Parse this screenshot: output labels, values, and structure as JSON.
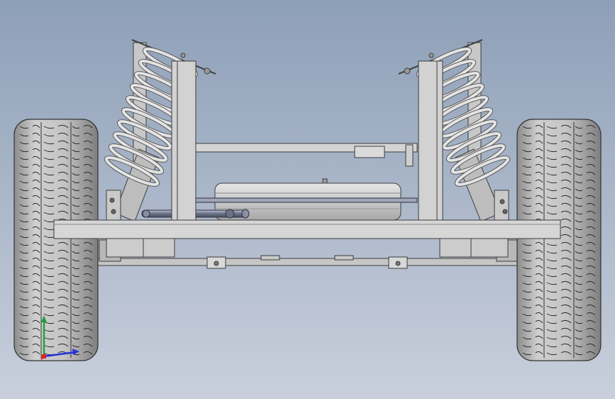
{
  "viewport": {
    "background_top": "#8D9FB7",
    "background_bottom": "#C9CFDC"
  },
  "model": {
    "part_fill": "#D0D0D0",
    "part_stroke": "#3C3C3C",
    "tire_fill": "#BDBDBD",
    "spring_fill": "#E2E2E2"
  },
  "triad": {
    "x_color": "#E0202A",
    "y_color": "#1EA03A",
    "z_color": "#2434D8"
  }
}
